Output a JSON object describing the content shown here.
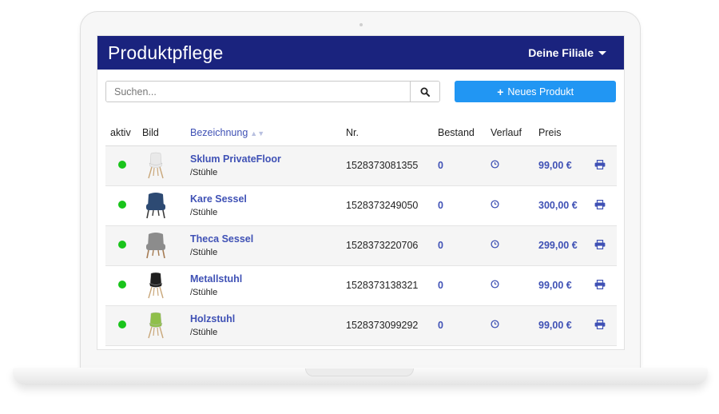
{
  "header": {
    "title": "Produktpflege",
    "branch_menu": "Deine Filiale"
  },
  "search": {
    "placeholder": "Suchen..."
  },
  "actions": {
    "new_product": "Neues Produkt"
  },
  "table": {
    "columns": {
      "active": "aktiv",
      "image": "Bild",
      "name": "Bezeichnung",
      "number": "Nr.",
      "stock": "Bestand",
      "history": "Verlauf",
      "price": "Preis"
    },
    "rows": [
      {
        "name": "Sklum PrivateFloor",
        "category": "/Stühle",
        "number": "1528373081355",
        "stock": "0",
        "price": "99,00 €",
        "image_icon": "white-chair"
      },
      {
        "name": "Kare Sessel",
        "category": "/Stühle",
        "number": "1528373249050",
        "stock": "0",
        "price": "300,00 €",
        "image_icon": "blue-armchair"
      },
      {
        "name": "Theca Sessel",
        "category": "/Stühle",
        "number": "1528373220706",
        "stock": "0",
        "price": "299,00 €",
        "image_icon": "grey-armchair"
      },
      {
        "name": "Metallstuhl",
        "category": "/Stühle",
        "number": "1528373138321",
        "stock": "0",
        "price": "99,00 €",
        "image_icon": "black-chair"
      },
      {
        "name": "Holzstuhl",
        "category": "/Stühle",
        "number": "1528373099292",
        "stock": "0",
        "price": "99,00 €",
        "image_icon": "green-chair"
      }
    ]
  },
  "colors": {
    "header_bg": "#1a237e",
    "accent": "#3f51b5",
    "button": "#2196f3",
    "active_dot": "#19c41b"
  }
}
